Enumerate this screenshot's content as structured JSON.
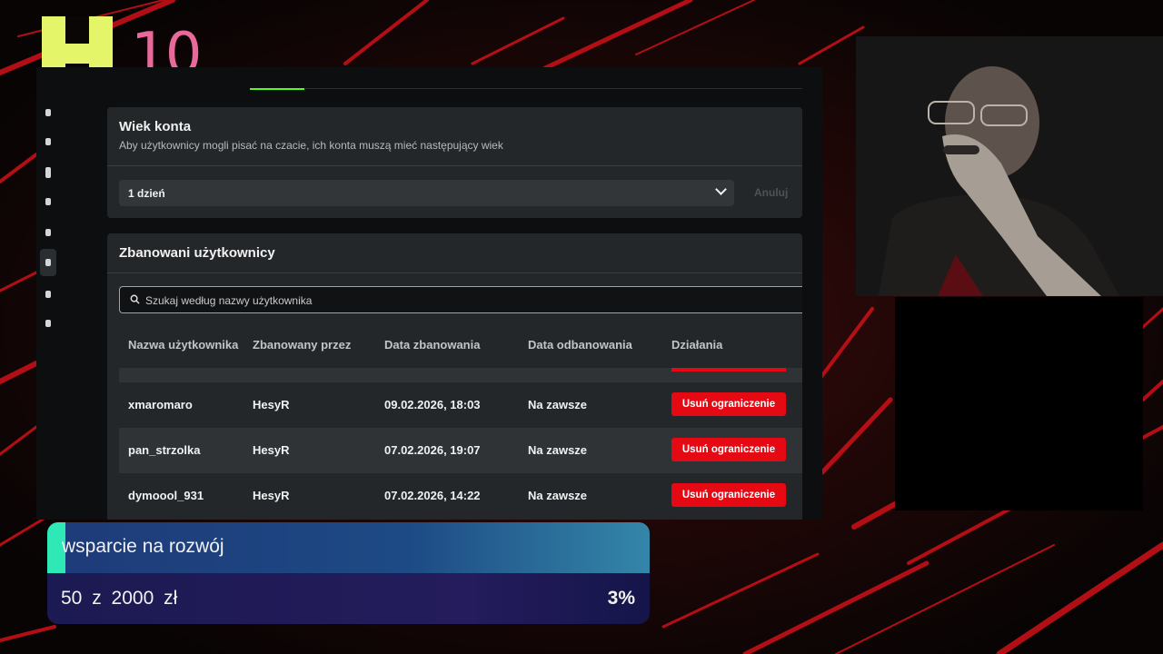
{
  "branding": {
    "logo_text": "10",
    "colors": {
      "k_mark": "#e4f56a",
      "logo_text": "#e8699a"
    }
  },
  "theme": {
    "kick_green": "#53fc18",
    "danger_red": "#e50914",
    "goal_fill": "#2ee8b5"
  },
  "account_age": {
    "title": "Wiek konta",
    "description": "Aby użytkownicy mogli pisać na czacie, ich konta muszą mieć następujący wiek",
    "select_value": "1 dzień",
    "cancel_label": "Anuluj"
  },
  "banned_users": {
    "title": "Zbanowani użytkownicy",
    "search_placeholder": "Szukaj według nazwy użytkownika",
    "columns": [
      "Nazwa użytkownika",
      "Zbanowany przez",
      "Data zbanowania",
      "Data odbanowania",
      "Działania"
    ],
    "rows": [
      {
        "username": "xmaromaro",
        "banned_by": "HesyR",
        "ban_date": "09.02.2026, 18:03",
        "unban_date": "Na zawsze",
        "action": "Usuń ograniczenie"
      },
      {
        "username": "pan_strzolka",
        "banned_by": "HesyR",
        "ban_date": "07.02.2026, 19:07",
        "unban_date": "Na zawsze",
        "action": "Usuń ograniczenie"
      },
      {
        "username": "dymoool_931",
        "banned_by": "HesyR",
        "ban_date": "07.02.2026, 14:22",
        "unban_date": "Na zawsze",
        "action": "Usuń ograniczenie"
      }
    ]
  },
  "goal": {
    "title": "wsparcie na rozwój",
    "amount_text": "50 z 2000 zł",
    "percent_text": "3%",
    "progress": 0.03
  }
}
